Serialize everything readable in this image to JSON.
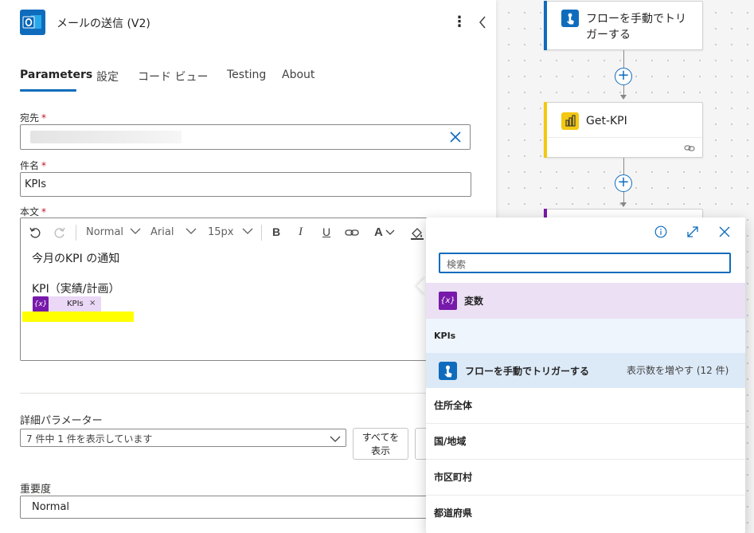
{
  "panel": {
    "title": "メールの送信 (V2)",
    "tabs": [
      {
        "label": "Parameters"
      },
      {
        "label": "設定"
      },
      {
        "label": "コード ビュー"
      },
      {
        "label": "Testing"
      },
      {
        "label": "About"
      }
    ],
    "to": {
      "label": "宛先",
      "required": "*"
    },
    "subject": {
      "label": "件名",
      "required": "*",
      "value": "KPIs"
    },
    "body": {
      "label": "本文",
      "required": "*",
      "toolbar": {
        "style": "Normal",
        "font": "Arial",
        "size": "15px"
      },
      "line1": "今月のKPI の通知",
      "line2": "KPI（実績/計画）",
      "token": {
        "icon_text": "{x}",
        "label": "KPIs",
        "remove": "×"
      }
    },
    "advanced": {
      "label": "詳細パラメーター",
      "summary": "7 件中 1 件を表示しています",
      "show_all": "すべてを表示"
    },
    "importance": {
      "label": "重要度",
      "value": "Normal"
    }
  },
  "flow": {
    "trigger": {
      "title": "フローを手動でトリガーする"
    },
    "getkpi": {
      "title": "Get-KPI"
    }
  },
  "popup": {
    "search_placeholder": "検索",
    "section_variables": {
      "icon_text": "{x}",
      "label": "変数"
    },
    "item_kpis": "KPIs",
    "section_trigger": {
      "label": "フローを手動でトリガーする",
      "more": "表示数を増やす (12 件)"
    },
    "items": [
      "住所全体",
      "国/地域",
      "市区町村",
      "都道府県"
    ]
  },
  "colors": {
    "accent": "#0f6cbd",
    "variable_purple": "#7719aa",
    "powerbi_yellow": "#f2c811",
    "highlight": "#ffff00"
  }
}
